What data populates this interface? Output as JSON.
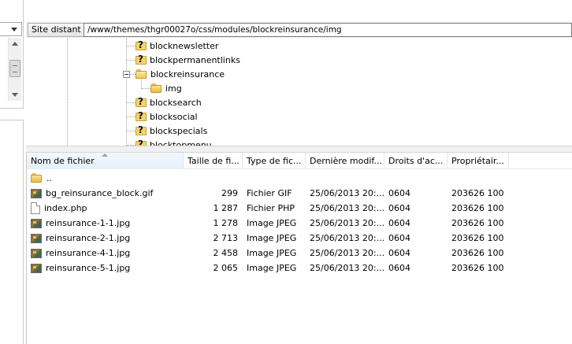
{
  "remote_site": {
    "label": "Site distant :",
    "path": "/www/themes/thgr00027o/css/modules/blockreinsurance/img"
  },
  "tree": {
    "items": [
      {
        "label": "blocknewsletter",
        "icon": "unknown-folder-icon"
      },
      {
        "label": "blockpermanentlinks",
        "icon": "unknown-folder-icon"
      },
      {
        "label": "blockreinsurance",
        "icon": "open-folder-icon"
      },
      {
        "label": "img",
        "icon": "folder-icon"
      },
      {
        "label": "blocksearch",
        "icon": "unknown-folder-icon"
      },
      {
        "label": "blocksocial",
        "icon": "unknown-folder-icon"
      },
      {
        "label": "blockspecials",
        "icon": "unknown-folder-icon"
      },
      {
        "label": "blocktopmenu",
        "icon": "unknown-folder-icon"
      }
    ]
  },
  "file_list": {
    "columns": [
      "Nom de fichier",
      "Taille de fi...",
      "Type de fic...",
      "Dernière modif...",
      "Droits d'ac...",
      "Propriétair..."
    ],
    "sorted_column": "Nom de fichier",
    "rows": [
      {
        "name": "..",
        "size": "",
        "type": "",
        "date": "",
        "perm": "",
        "owner": "",
        "icon": "folder-icon"
      },
      {
        "name": "bg_reinsurance_block.gif",
        "size": "299",
        "type": "Fichier GIF",
        "date": "25/06/2013 20:...",
        "perm": "0604",
        "owner": "203626 100",
        "icon": "image-file-icon"
      },
      {
        "name": "index.php",
        "size": "1 287",
        "type": "Fichier PHP",
        "date": "25/06/2013 20:...",
        "perm": "0604",
        "owner": "203626 100",
        "icon": "document-icon"
      },
      {
        "name": "reinsurance-1-1.jpg",
        "size": "1 278",
        "type": "Image JPEG",
        "date": "25/06/2013 20:...",
        "perm": "0604",
        "owner": "203626 100",
        "icon": "image-file-icon"
      },
      {
        "name": "reinsurance-2-1.jpg",
        "size": "2 713",
        "type": "Image JPEG",
        "date": "25/06/2013 20:...",
        "perm": "0604",
        "owner": "203626 100",
        "icon": "image-file-icon"
      },
      {
        "name": "reinsurance-4-1.jpg",
        "size": "2 458",
        "type": "Image JPEG",
        "date": "25/06/2013 20:...",
        "perm": "0604",
        "owner": "203626 100",
        "icon": "image-file-icon"
      },
      {
        "name": "reinsurance-5-1.jpg",
        "size": "2 065",
        "type": "Image JPEG",
        "date": "25/06/2013 20:...",
        "perm": "0604",
        "owner": "203626 100",
        "icon": "image-file-icon"
      }
    ]
  }
}
